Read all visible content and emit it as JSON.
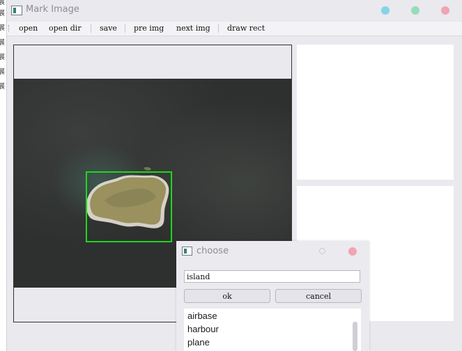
{
  "window": {
    "title": "Mark Image",
    "controls": {
      "minimize_color": "#85d3e3",
      "maximize_color": "#99dbb8",
      "close_color": "#eea5b4"
    }
  },
  "left_strip": {
    "chars": [
      "展",
      "展",
      "展",
      "展",
      "展",
      "展",
      "展",
      "展"
    ]
  },
  "toolbar": {
    "items": [
      "open",
      "open dir",
      "save",
      "pre img",
      "next img",
      "draw rect"
    ]
  },
  "annotation": {
    "box_color": "#1ed81a"
  },
  "dialog": {
    "title": "choose",
    "input_value": "island",
    "ok_label": "ok",
    "cancel_label": "cancel",
    "options": [
      "airbase",
      "harbour",
      "plane"
    ]
  }
}
